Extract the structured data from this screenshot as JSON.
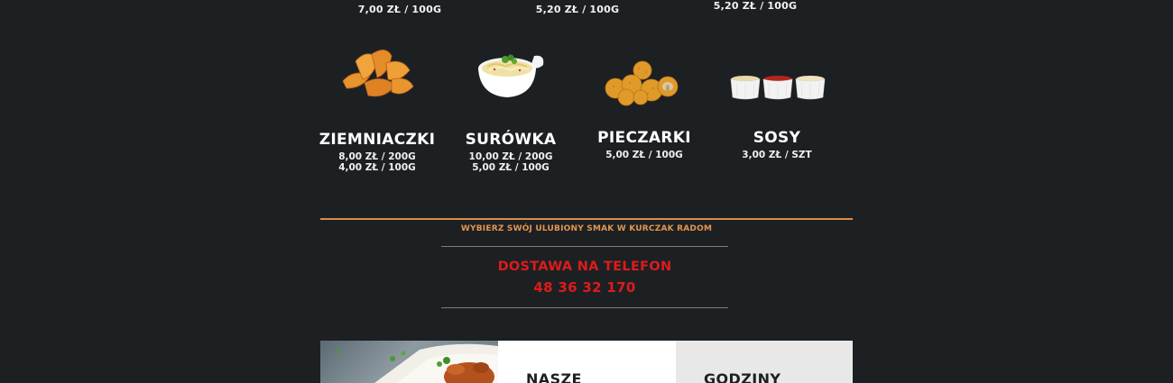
{
  "top_prices": [
    "7,00 ZŁ / 100G",
    "5,20 ZŁ / 100G",
    "5,20 ZŁ / 100G"
  ],
  "items": [
    {
      "icon": "potato-wedges-icon",
      "name": "ZIEMNIACZKI",
      "prices": [
        "8,00 ZŁ / 200G",
        "4,00 ZŁ / 100G"
      ]
    },
    {
      "icon": "coleslaw-bowl-icon",
      "name": "SURÓWKA",
      "prices": [
        "10,00 ZŁ / 200G",
        "5,00 ZŁ / 100G"
      ]
    },
    {
      "icon": "fried-mushrooms-icon",
      "name": "PIECZARKI",
      "prices": [
        "5,00 ZŁ / 100G"
      ]
    },
    {
      "icon": "sauce-cups-icon",
      "name": "SOSY",
      "prices": [
        "3,00 ZŁ / SZT"
      ]
    }
  ],
  "tagline": "WYBIERZ SWÓJ ULUBIONY SMAK W KURCZAK RADOM",
  "delivery": {
    "label": "DOSTAWA NA TELEFON",
    "phone": "48 36 32 170"
  },
  "cards": [
    {
      "title": ""
    },
    {
      "title": "NASZE"
    },
    {
      "title": "GODZINY"
    }
  ],
  "colors": {
    "background": "#1d2023",
    "accent_orange": "#d98d4a",
    "accent_red": "#dd1b1b"
  }
}
